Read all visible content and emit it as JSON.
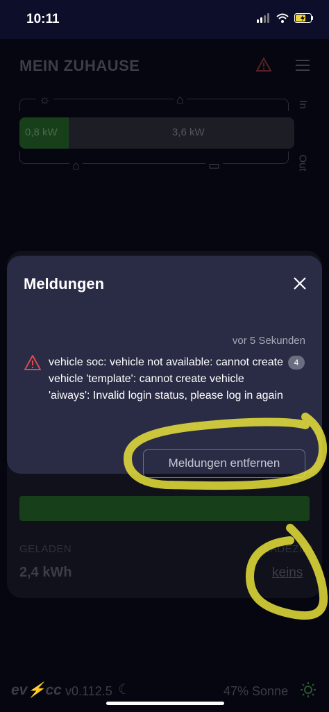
{
  "status_bar": {
    "time": "10:11"
  },
  "header": {
    "title": "MEIN ZUHAUSE",
    "icons": [
      "warning-icon",
      "menu-icon"
    ]
  },
  "energy_flow": {
    "in_label": "In",
    "out_label": "Out",
    "pv_power": "0,8 kW",
    "grid_power": "3,6 kW",
    "pv_fraction": 0.18,
    "icons": [
      "sun-icon",
      "grid-pylon-icon",
      "home-icon",
      "car-icon"
    ]
  },
  "loadpoint": {
    "charged_label": "GELADEN",
    "charged_value": "2,4 kWh",
    "target_label": "LADEZIEL",
    "target_value": "keins"
  },
  "footer": {
    "logo": "ev⚡cc",
    "version": "v0.112.5",
    "sun_status": "47% Sonne"
  },
  "modal": {
    "title": "Meldungen",
    "messages": [
      {
        "time": "vor 5 Sekunden",
        "text": "vehicle soc: vehicle not available: cannot create vehicle 'template': cannot create vehicle 'aiways': Invalid login status, please log in again",
        "count": "4"
      }
    ],
    "clear_button": "Meldungen entfernen"
  },
  "colors": {
    "modal_bg": "#2a2c46",
    "warning_red": "#e0484a",
    "pv_green": "#173f1a",
    "highlight_yellow": "#e8e23a"
  }
}
